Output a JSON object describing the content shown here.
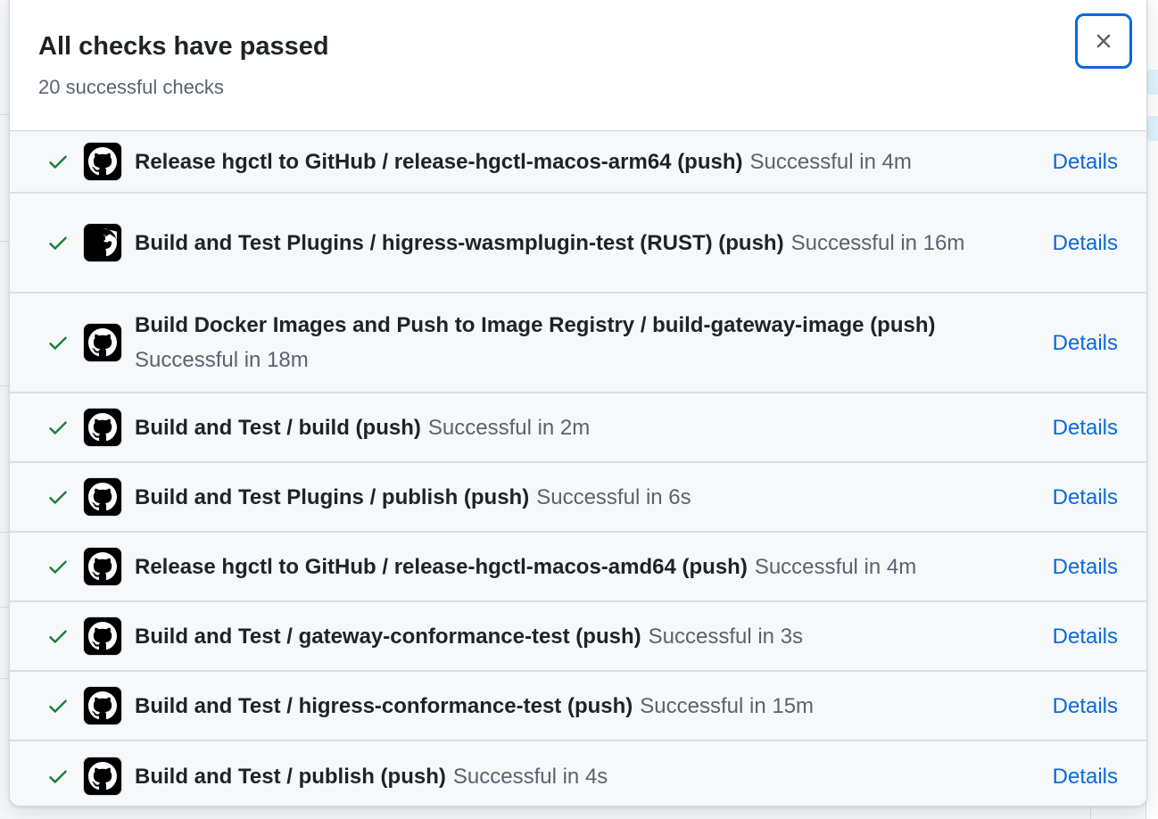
{
  "dialog": {
    "title": "All checks have passed",
    "subtitle": "20 successful checks",
    "close_icon": "x-icon"
  },
  "colors": {
    "success": "#1a7f37",
    "link": "#0969da",
    "muted": "#59636e",
    "focus_ring": "#0969da"
  },
  "checks": [
    {
      "name": "Release hgctl to GitHub / release-hgctl-macos-arm64 (push)",
      "status": "Successful in 4m",
      "link": "Details",
      "icon": "check-icon",
      "avatar": "github-actions-icon"
    },
    {
      "name": "Build and Test Plugins / higress-wasmplugin-test (RUST) (push)",
      "status": "Successful in 16m",
      "link": "Details",
      "icon": "check-icon",
      "avatar": "github-actions-icon"
    },
    {
      "name": "Build Docker Images and Push to Image Registry / build-gateway-image (push)",
      "status": "Successful in 18m",
      "link": "Details",
      "icon": "check-icon",
      "avatar": "github-actions-icon"
    },
    {
      "name": "Build and Test / build (push)",
      "status": "Successful in 2m",
      "link": "Details",
      "icon": "check-icon",
      "avatar": "github-actions-icon"
    },
    {
      "name": "Build and Test Plugins / publish (push)",
      "status": "Successful in 6s",
      "link": "Details",
      "icon": "check-icon",
      "avatar": "github-actions-icon"
    },
    {
      "name": "Release hgctl to GitHub / release-hgctl-macos-amd64 (push)",
      "status": "Successful in 4m",
      "link": "Details",
      "icon": "check-icon",
      "avatar": "github-actions-icon"
    },
    {
      "name": "Build and Test / gateway-conformance-test (push)",
      "status": "Successful in 3s",
      "link": "Details",
      "icon": "check-icon",
      "avatar": "github-actions-icon"
    },
    {
      "name": "Build and Test / higress-conformance-test (push)",
      "status": "Successful in 15m",
      "link": "Details",
      "icon": "check-icon",
      "avatar": "github-actions-icon"
    },
    {
      "name": "Build and Test / publish (push)",
      "status": "Successful in 4s",
      "link": "Details",
      "icon": "check-icon",
      "avatar": "github-actions-icon"
    }
  ]
}
